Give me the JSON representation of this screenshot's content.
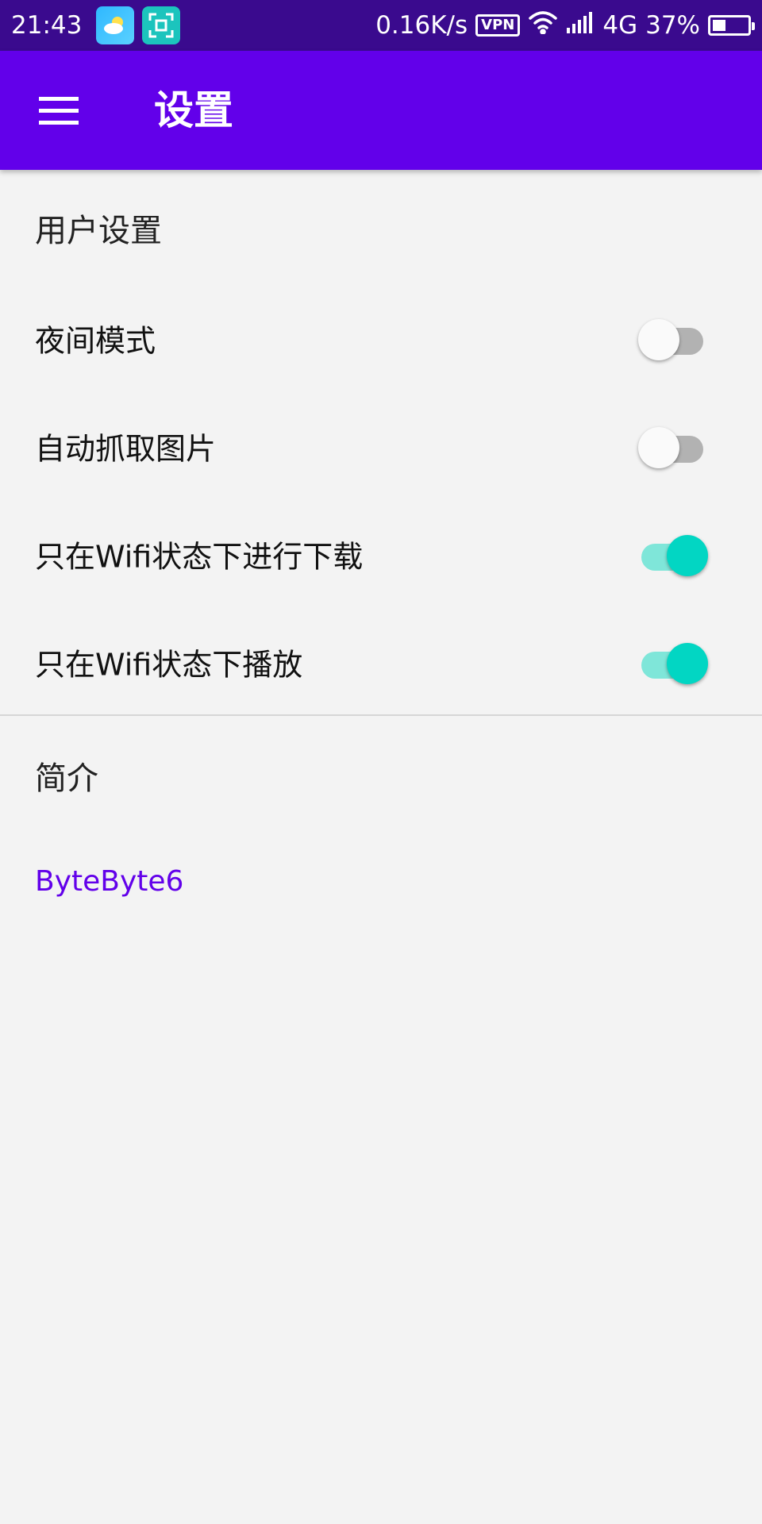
{
  "status_bar": {
    "time": "21:43",
    "net_speed": "0.16K/s",
    "vpn": "VPN",
    "network": "4G",
    "battery": "37%",
    "battery_level": 0.37,
    "icons": [
      "weather-app-icon",
      "screenshot-scan-icon",
      "wifi-icon",
      "signal-icon",
      "battery-icon"
    ]
  },
  "app_bar": {
    "title": "设置",
    "menu_icon": "hamburger-menu-icon",
    "color": "#6200ea"
  },
  "user_settings": {
    "title": "用户设置",
    "items": [
      {
        "label": "夜间模式",
        "enabled": false
      },
      {
        "label": "自动抓取图片",
        "enabled": false
      },
      {
        "label": "只在Wifi状态下进行下载",
        "enabled": true
      },
      {
        "label": "只在Wifi状态下播放",
        "enabled": true
      }
    ]
  },
  "intro": {
    "title": "简介",
    "text": "ByteByte6"
  },
  "colors": {
    "accent": "#02d6c3",
    "primary": "#6200ea",
    "status_bar": "#3a0a8e"
  }
}
